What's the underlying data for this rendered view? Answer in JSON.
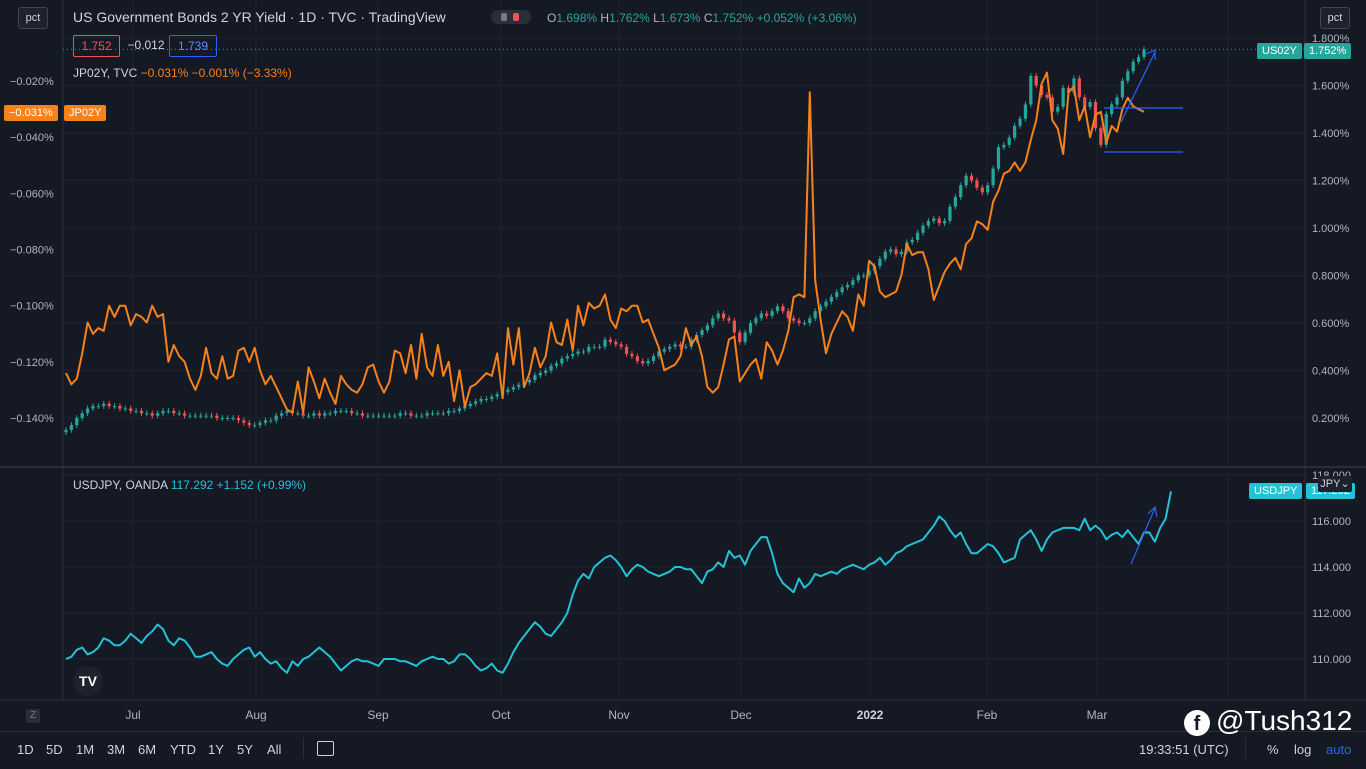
{
  "header": {
    "title": "US Government Bonds 2 YR Yield · 1D · TVC · TradingView",
    "ohlc": {
      "o_label": "O",
      "o": "1.698%",
      "h_label": "H",
      "h": "1.762%",
      "l_label": "L",
      "l": "1.673%",
      "c_label": "C",
      "c": "1.752%",
      "change": "+0.052% (+3.06%)"
    },
    "box_red": "1.752",
    "box_mid": "−0.012",
    "box_blue": "1.739"
  },
  "scale_buttons": {
    "left": "pct",
    "right": "pct"
  },
  "jp_legend": {
    "name": "JP02Y, TVC",
    "values": "−0.031%  −0.001% (−3.33%)"
  },
  "usdjpy_legend": {
    "name": "USDJPY, OANDA",
    "values": "117.292  +1.152 (+0.99%)"
  },
  "price_tags": {
    "us02y_symbol": "US02Y",
    "us02y_value": "1.752%",
    "jp02y_value": "−0.031%",
    "jp02y_symbol": "JP02Y",
    "usdjpy_symbol": "USDJPY",
    "usdjpy_value": "117.292",
    "jpy_button": "JPY⌄"
  },
  "bottom_toolbar": {
    "timeframes": [
      "1D",
      "5D",
      "1M",
      "3M",
      "6M",
      "YTD",
      "1Y",
      "5Y",
      "All"
    ],
    "time": "19:33:51 (UTC)",
    "pct": "%",
    "log": "log",
    "auto": "auto",
    "z_label": "Z"
  },
  "watermark": "@Tush312",
  "colors": {
    "background": "#151924",
    "up": "#26a69a",
    "down": "#ef5350",
    "jp02y": "#f7821b",
    "usdjpy": "#22c3d6",
    "annotation": "#2962ff",
    "us02y_tag": "#26a69a"
  },
  "chart_data": [
    {
      "type": "candlestick",
      "title": "US Government Bonds 2 YR Yield · 1D · TVC",
      "series_name": "US02Y",
      "axis": "right",
      "y_ticks": [
        "0.200%",
        "0.400%",
        "0.600%",
        "0.800%",
        "1.000%",
        "1.200%",
        "1.400%",
        "1.600%",
        "1.800%"
      ],
      "ylim": [
        0.1,
        1.85
      ],
      "x_ticks": [
        "Jul",
        "Aug",
        "Sep",
        "Oct",
        "Nov",
        "Dec",
        "2022",
        "Feb",
        "Mar"
      ],
      "close": [
        0.15,
        0.17,
        0.2,
        0.22,
        0.24,
        0.25,
        0.25,
        0.26,
        0.25,
        0.25,
        0.24,
        0.24,
        0.23,
        0.23,
        0.22,
        0.22,
        0.21,
        0.22,
        0.23,
        0.23,
        0.22,
        0.22,
        0.21,
        0.21,
        0.21,
        0.21,
        0.21,
        0.21,
        0.2,
        0.2,
        0.2,
        0.2,
        0.19,
        0.18,
        0.17,
        0.17,
        0.18,
        0.19,
        0.19,
        0.21,
        0.22,
        0.23,
        0.22,
        0.22,
        0.21,
        0.21,
        0.22,
        0.21,
        0.22,
        0.22,
        0.23,
        0.23,
        0.23,
        0.22,
        0.22,
        0.21,
        0.21,
        0.21,
        0.21,
        0.21,
        0.21,
        0.21,
        0.22,
        0.22,
        0.21,
        0.21,
        0.21,
        0.22,
        0.22,
        0.22,
        0.22,
        0.23,
        0.23,
        0.24,
        0.25,
        0.26,
        0.27,
        0.28,
        0.28,
        0.29,
        0.3,
        0.31,
        0.32,
        0.33,
        0.34,
        0.35,
        0.36,
        0.38,
        0.39,
        0.4,
        0.42,
        0.43,
        0.45,
        0.46,
        0.47,
        0.48,
        0.48,
        0.5,
        0.5,
        0.5,
        0.53,
        0.52,
        0.51,
        0.5,
        0.47,
        0.46,
        0.44,
        0.43,
        0.44,
        0.46,
        0.48,
        0.49,
        0.5,
        0.51,
        0.5,
        0.5,
        0.53,
        0.55,
        0.57,
        0.59,
        0.62,
        0.64,
        0.62,
        0.61,
        0.56,
        0.52,
        0.56,
        0.6,
        0.62,
        0.64,
        0.63,
        0.65,
        0.67,
        0.65,
        0.62,
        0.61,
        0.6,
        0.6,
        0.62,
        0.65,
        0.67,
        0.69,
        0.71,
        0.73,
        0.75,
        0.76,
        0.78,
        0.8,
        0.8,
        0.82,
        0.84,
        0.87,
        0.9,
        0.91,
        0.89,
        0.9,
        0.94,
        0.95,
        0.98,
        1.01,
        1.03,
        1.04,
        1.02,
        1.03,
        1.09,
        1.13,
        1.18,
        1.22,
        1.2,
        1.17,
        1.15,
        1.18,
        1.25,
        1.34,
        1.35,
        1.38,
        1.43,
        1.46,
        1.52,
        1.64,
        1.6,
        1.56,
        1.55,
        1.49,
        1.51,
        1.59,
        1.57,
        1.63,
        1.55,
        1.51,
        1.53,
        1.42,
        1.35,
        1.48,
        1.52,
        1.55,
        1.62,
        1.66,
        1.7,
        1.72,
        1.752
      ]
    },
    {
      "type": "line",
      "series_name": "JP02Y",
      "axis": "left",
      "y_ticks": [
        "−0.020%",
        "−0.040%",
        "−0.060%",
        "−0.080%",
        "−0.100%",
        "−0.120%",
        "−0.140%"
      ],
      "ylim": [
        -0.1455,
        -0.0135
      ],
      "values": [
        -0.124,
        -0.128,
        -0.126,
        -0.117,
        -0.106,
        -0.11,
        -0.108,
        -0.109,
        -0.1,
        -0.104,
        -0.1,
        -0.1,
        -0.107,
        -0.103,
        -0.104,
        -0.106,
        -0.1,
        -0.104,
        -0.103,
        -0.12,
        -0.114,
        -0.118,
        -0.12,
        -0.126,
        -0.13,
        -0.125,
        -0.115,
        -0.124,
        -0.126,
        -0.118,
        -0.126,
        -0.125,
        -0.116,
        -0.115,
        -0.12,
        -0.115,
        -0.123,
        -0.128,
        -0.125,
        -0.129,
        -0.133,
        -0.137,
        -0.138,
        -0.127,
        -0.138,
        -0.122,
        -0.127,
        -0.133,
        -0.126,
        -0.131,
        -0.135,
        -0.125,
        -0.128,
        -0.13,
        -0.131,
        -0.128,
        -0.122,
        -0.121,
        -0.127,
        -0.131,
        -0.127,
        -0.116,
        -0.117,
        -0.124,
        -0.114,
        -0.126,
        -0.11,
        -0.122,
        -0.125,
        -0.114,
        -0.125,
        -0.12,
        -0.134,
        -0.123,
        -0.136,
        -0.129,
        -0.128,
        -0.126,
        -0.124,
        -0.125,
        -0.117,
        -0.133,
        -0.108,
        -0.121,
        -0.108,
        -0.129,
        -0.124,
        -0.115,
        -0.122,
        -0.118,
        -0.106,
        -0.113,
        -0.114,
        -0.105,
        -0.116,
        -0.1,
        -0.107,
        -0.099,
        -0.101,
        -0.1,
        -0.096,
        -0.105,
        -0.108,
        -0.101,
        -0.102,
        -0.1,
        -0.1,
        -0.106,
        -0.105,
        -0.11,
        -0.115,
        -0.123,
        -0.122,
        -0.121,
        -0.118,
        -0.108,
        -0.114,
        -0.111,
        -0.118,
        -0.129,
        -0.131,
        -0.129,
        -0.121,
        -0.112,
        -0.111,
        -0.127,
        -0.124,
        -0.121,
        -0.119,
        -0.126,
        -0.113,
        -0.116,
        -0.121,
        -0.116,
        -0.109,
        -0.097,
        -0.096,
        -0.097,
        -0.024,
        -0.091,
        -0.105,
        -0.117,
        -0.11,
        -0.106,
        -0.102,
        -0.104,
        -0.109,
        -0.096,
        -0.1,
        -0.084,
        -0.086,
        -0.095,
        -0.097,
        -0.096,
        -0.095,
        -0.089,
        -0.078,
        -0.082,
        -0.081,
        -0.081,
        -0.087,
        -0.098,
        -0.093,
        -0.088,
        -0.085,
        -0.083,
        -0.087,
        -0.078,
        -0.076,
        -0.07,
        -0.071,
        -0.073,
        -0.063,
        -0.059,
        -0.053,
        -0.052,
        -0.049,
        -0.052,
        -0.049,
        -0.041,
        -0.034,
        -0.021,
        -0.017,
        -0.034,
        -0.037,
        -0.046,
        -0.024,
        -0.022,
        -0.034,
        -0.029,
        -0.04,
        -0.032,
        -0.031,
        -0.042,
        -0.036,
        -0.038,
        -0.03,
        -0.026,
        -0.029,
        -0.03,
        -0.031
      ]
    },
    {
      "type": "line",
      "title": "USDJPY, OANDA",
      "series_name": "USDJPY",
      "axis": "right",
      "y_ticks": [
        "110.000",
        "112.000",
        "114.000",
        "116.000",
        "118.000"
      ],
      "ylim": [
        109,
        118.2
      ],
      "values": [
        110.0,
        110.1,
        110.4,
        110.5,
        110.2,
        110.3,
        110.5,
        110.9,
        110.8,
        110.6,
        110.6,
        110.8,
        111.1,
        110.9,
        110.7,
        111.0,
        111.2,
        111.5,
        111.3,
        110.8,
        110.6,
        110.9,
        110.8,
        110.5,
        110.1,
        110.1,
        110.2,
        110.3,
        110.0,
        109.8,
        109.7,
        110.0,
        110.2,
        110.4,
        110.5,
        110.1,
        110.3,
        110.0,
        109.8,
        109.9,
        109.6,
        109.4,
        109.9,
        109.7,
        110.0,
        110.1,
        110.3,
        110.5,
        110.3,
        110.1,
        109.8,
        109.5,
        109.7,
        109.9,
        110.0,
        109.9,
        109.9,
        109.8,
        109.7,
        110.0,
        110.0,
        110.0,
        109.9,
        109.9,
        109.8,
        109.7,
        109.9,
        110.0,
        110.1,
        110.0,
        110.0,
        109.8,
        109.9,
        110.2,
        110.2,
        110.0,
        109.7,
        109.5,
        109.6,
        109.8,
        109.5,
        109.4,
        109.8,
        110.3,
        110.7,
        111.0,
        111.3,
        111.6,
        111.4,
        111.1,
        111.0,
        111.3,
        111.6,
        112.0,
        112.8,
        113.4,
        113.7,
        113.5,
        114.0,
        114.2,
        114.4,
        114.5,
        114.3,
        114.0,
        113.6,
        113.9,
        114.1,
        114.0,
        113.8,
        113.7,
        113.6,
        113.7,
        113.8,
        114.0,
        114.0,
        113.9,
        113.9,
        113.6,
        113.3,
        113.8,
        113.9,
        114.2,
        114.0,
        114.7,
        114.4,
        114.5,
        114.1,
        114.7,
        115.0,
        115.3,
        115.3,
        114.6,
        113.7,
        113.3,
        113.1,
        112.9,
        113.5,
        113.1,
        113.3,
        113.7,
        113.6,
        113.7,
        113.8,
        113.7,
        113.9,
        114.0,
        114.1,
        114.0,
        113.9,
        114.1,
        114.2,
        114.4,
        114.1,
        114.3,
        114.6,
        114.7,
        114.9,
        115.0,
        115.1,
        115.2,
        115.5,
        115.8,
        116.2,
        116.0,
        115.6,
        115.3,
        115.5,
        115.0,
        114.6,
        114.6,
        114.8,
        115.0,
        114.9,
        114.6,
        114.2,
        114.3,
        114.4,
        115.2,
        115.4,
        115.6,
        115.2,
        114.7,
        115.2,
        115.5,
        115.6,
        115.7,
        115.7,
        115.7,
        115.6,
        116.1,
        115.6,
        115.8,
        115.6,
        115.2,
        115.4,
        115.5,
        115.3,
        115.6,
        115.3,
        115.0,
        115.5,
        115.5,
        115.1,
        115.7,
        116.1,
        117.292
      ]
    }
  ]
}
